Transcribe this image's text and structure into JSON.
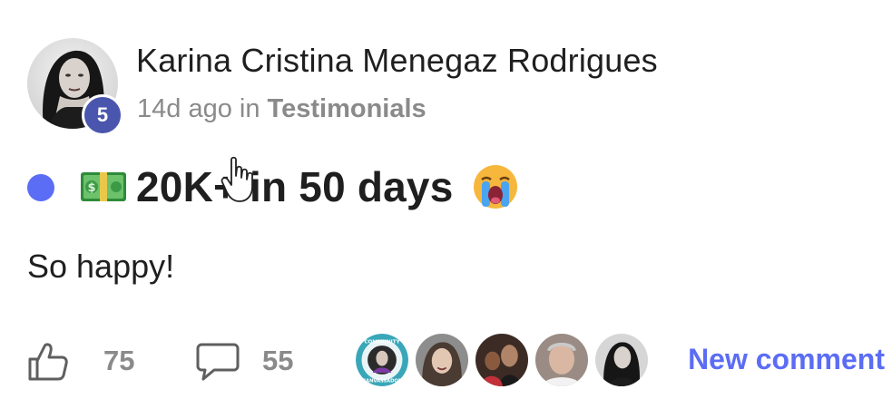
{
  "post": {
    "author": {
      "name": "Karina Cristina Menegaz Rodrigues",
      "level": "5"
    },
    "meta": {
      "time": "14d ago",
      "in_word": "in",
      "category": "Testimonials"
    },
    "title": {
      "emoji_left": "money-with-wings-emoji",
      "text": "20K+ in 50 days",
      "emoji_right": "loudly-crying-face-emoji"
    },
    "body": "So happy!",
    "footer": {
      "likes": "75",
      "comments": "55",
      "new_comment_label": "New comment",
      "participant_badge_text_top": "COMMUNITY",
      "participant_badge_text_bottom": "CANVASSADOR"
    }
  },
  "colors": {
    "accent": "#5b6df5",
    "level_badge": "#4a56ad",
    "muted_text": "#8a8a8a",
    "text": "#1f1f1f"
  }
}
